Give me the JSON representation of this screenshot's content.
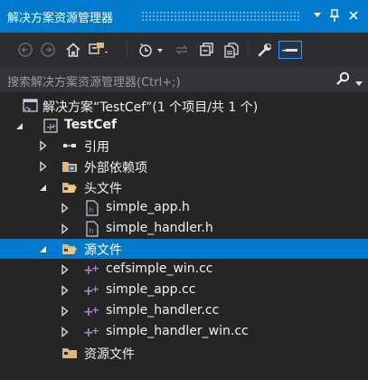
{
  "panel": {
    "title": "解决方案资源管理器",
    "pin_label": "▾",
    "close_label": "×"
  },
  "toolbar": {
    "buttons": [
      {
        "icon": "back-arrow-icon"
      },
      {
        "icon": "forward-arrow-icon"
      },
      {
        "icon": "home-icon"
      },
      {
        "icon": "switch-views-icon"
      },
      {
        "icon": "pending-changes-filter-icon"
      },
      {
        "icon": "sync-with-active-document-icon"
      },
      {
        "icon": "collapse-all-icon"
      },
      {
        "icon": "show-all-files-icon"
      },
      {
        "icon": "properties-wrench-icon"
      },
      {
        "icon": "preview-selected-items-icon"
      }
    ]
  },
  "search": {
    "placeholder": "搜索解决方案资源管理器(Ctrl+;)"
  },
  "tree": {
    "solution_label": "解决方案“TestCef”(1 个项目/共 1 个)",
    "project_label": "TestCef",
    "references_label": "引用",
    "external_deps_label": "外部依赖项",
    "header_files_label": "头文件",
    "header_files": [
      "simple_app.h",
      "simple_handler.h"
    ],
    "source_files_label": "源文件",
    "source_files": [
      "cefsimple_win.cc",
      "simple_app.cc",
      "simple_handler.cc",
      "simple_handler_win.cc"
    ],
    "resource_files_label": "资源文件"
  },
  "colors": {
    "accent": "#007acc",
    "background": "#252526",
    "toolbar": "#2d2d30",
    "search_bg": "#333337",
    "folder": "#dcb67a",
    "cpp_source": "#b180d7"
  }
}
